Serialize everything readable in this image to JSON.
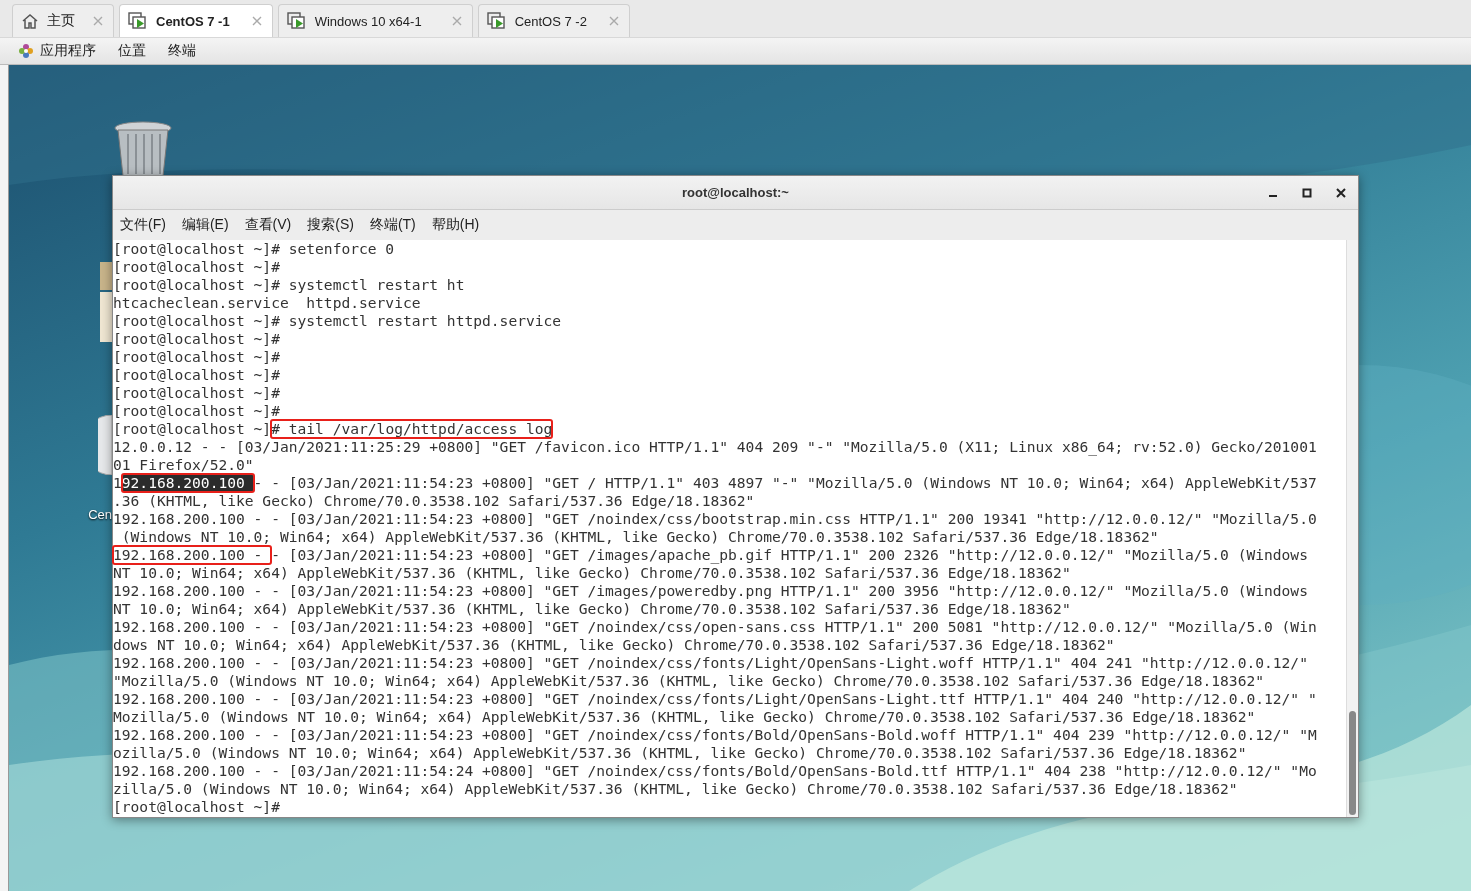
{
  "tabs": [
    {
      "label": "主页",
      "kind": "home",
      "selected": false
    },
    {
      "label": "CentOS 7 -1",
      "kind": "vm",
      "selected": true
    },
    {
      "label": "Windows 10 x64-1",
      "kind": "vm",
      "selected": false
    },
    {
      "label": "CentOS 7 -2",
      "kind": "vm",
      "selected": false
    }
  ],
  "top_bar": {
    "menus": [
      "应用程序",
      "位置",
      "终端"
    ]
  },
  "desktop": {
    "icons": [
      {
        "kind": "trash"
      },
      {
        "kind": "file"
      },
      {
        "kind": "disc",
        "label": "Cen"
      }
    ]
  },
  "terminal": {
    "title": "root@localhost:~",
    "menu": [
      "文件(F)",
      "编辑(E)",
      "查看(V)",
      "搜索(S)",
      "终端(T)",
      "帮助(H)"
    ],
    "lines": [
      {
        "text": "[root@localhost ~]# setenforce 0"
      },
      {
        "text": "[root@localhost ~]#"
      },
      {
        "text": "[root@localhost ~]# systemctl restart ht"
      },
      {
        "text": "htcacheclean.service  httpd.service"
      },
      {
        "text": "[root@localhost ~]# systemctl restart httpd.service"
      },
      {
        "text": "[root@localhost ~]#"
      },
      {
        "text": "[root@localhost ~]#"
      },
      {
        "text": "[root@localhost ~]#"
      },
      {
        "text": "[root@localhost ~]#"
      },
      {
        "text": "[root@localhost ~]#"
      },
      {
        "parts": [
          {
            "text": "[root@localhost ~]",
            "highlight": false,
            "boxed": false
          },
          {
            "text": "# tail /var/log/httpd/access_log",
            "highlight": false,
            "boxed": true
          }
        ]
      },
      {
        "text": "12.0.0.12 - - [03/Jan/2021:11:25:29 +0800] \"GET /favicon.ico HTTP/1.1\" 404 209 \"-\" \"Mozilla/5.0 (X11; Linux x86_64; rv:52.0) Gecko/201001"
      },
      {
        "text": "01 Firefox/52.0\""
      },
      {
        "parts": [
          {
            "text": "1",
            "highlight": false,
            "boxed": false
          },
          {
            "text": "92.168.200.100 ",
            "highlight": true,
            "boxed": true
          },
          {
            "text": "- - [03/Jan/2021:11:54:23 +0800] \"GET / HTTP/1.1\" 403 4897 \"-\" \"Mozilla/5.0 (Windows NT 10.0; Win64; x64) AppleWebKit/537",
            "highlight": false,
            "boxed": false
          }
        ]
      },
      {
        "text": ".36 (KHTML, like Gecko) Chrome/70.0.3538.102 Safari/537.36 Edge/18.18362\""
      },
      {
        "text": "192.168.200.100 - - [03/Jan/2021:11:54:23 +0800] \"GET /noindex/css/bootstrap.min.css HTTP/1.1\" 200 19341 \"http://12.0.0.12/\" \"Mozilla/5.0"
      },
      {
        "text": " (Windows NT 10.0; Win64; x64) AppleWebKit/537.36 (KHTML, like Gecko) Chrome/70.0.3538.102 Safari/537.36 Edge/18.18362\""
      },
      {
        "parts": [
          {
            "text": "192.168.200.100 - ",
            "highlight": false,
            "boxed": true
          },
          {
            "text": "- [03/Jan/2021:11:54:23 +0800] \"GET /images/apache_pb.gif HTTP/1.1\" 200 2326 \"http://12.0.0.12/\" \"Mozilla/5.0 (Windows",
            "highlight": false,
            "boxed": false
          }
        ]
      },
      {
        "text": "NT 10.0; Win64; x64) AppleWebKit/537.36 (KHTML, like Gecko) Chrome/70.0.3538.102 Safari/537.36 Edge/18.18362\""
      },
      {
        "text": "192.168.200.100 - - [03/Jan/2021:11:54:23 +0800] \"GET /images/poweredby.png HTTP/1.1\" 200 3956 \"http://12.0.0.12/\" \"Mozilla/5.0 (Windows"
      },
      {
        "text": "NT 10.0; Win64; x64) AppleWebKit/537.36 (KHTML, like Gecko) Chrome/70.0.3538.102 Safari/537.36 Edge/18.18362\""
      },
      {
        "text": "192.168.200.100 - - [03/Jan/2021:11:54:23 +0800] \"GET /noindex/css/open-sans.css HTTP/1.1\" 200 5081 \"http://12.0.0.12/\" \"Mozilla/5.0 (Win"
      },
      {
        "text": "dows NT 10.0; Win64; x64) AppleWebKit/537.36 (KHTML, like Gecko) Chrome/70.0.3538.102 Safari/537.36 Edge/18.18362\""
      },
      {
        "text": "192.168.200.100 - - [03/Jan/2021:11:54:23 +0800] \"GET /noindex/css/fonts/Light/OpenSans-Light.woff HTTP/1.1\" 404 241 \"http://12.0.0.12/\""
      },
      {
        "text": "\"Mozilla/5.0 (Windows NT 10.0; Win64; x64) AppleWebKit/537.36 (KHTML, like Gecko) Chrome/70.0.3538.102 Safari/537.36 Edge/18.18362\""
      },
      {
        "text": "192.168.200.100 - - [03/Jan/2021:11:54:23 +0800] \"GET /noindex/css/fonts/Light/OpenSans-Light.ttf HTTP/1.1\" 404 240 \"http://12.0.0.12/\" \""
      },
      {
        "text": "Mozilla/5.0 (Windows NT 10.0; Win64; x64) AppleWebKit/537.36 (KHTML, like Gecko) Chrome/70.0.3538.102 Safari/537.36 Edge/18.18362\""
      },
      {
        "text": "192.168.200.100 - - [03/Jan/2021:11:54:23 +0800] \"GET /noindex/css/fonts/Bold/OpenSans-Bold.woff HTTP/1.1\" 404 239 \"http://12.0.0.12/\" \"M"
      },
      {
        "text": "ozilla/5.0 (Windows NT 10.0; Win64; x64) AppleWebKit/537.36 (KHTML, like Gecko) Chrome/70.0.3538.102 Safari/537.36 Edge/18.18362\""
      },
      {
        "text": "192.168.200.100 - - [03/Jan/2021:11:54:24 +0800] \"GET /noindex/css/fonts/Bold/OpenSans-Bold.ttf HTTP/1.1\" 404 238 \"http://12.0.0.12/\" \"Mo"
      },
      {
        "text": "zilla/5.0 (Windows NT 10.0; Win64; x64) AppleWebKit/537.36 (KHTML, like Gecko) Chrome/70.0.3538.102 Safari/537.36 Edge/18.18362\""
      },
      {
        "text": "[root@localhost ~]#"
      }
    ]
  }
}
